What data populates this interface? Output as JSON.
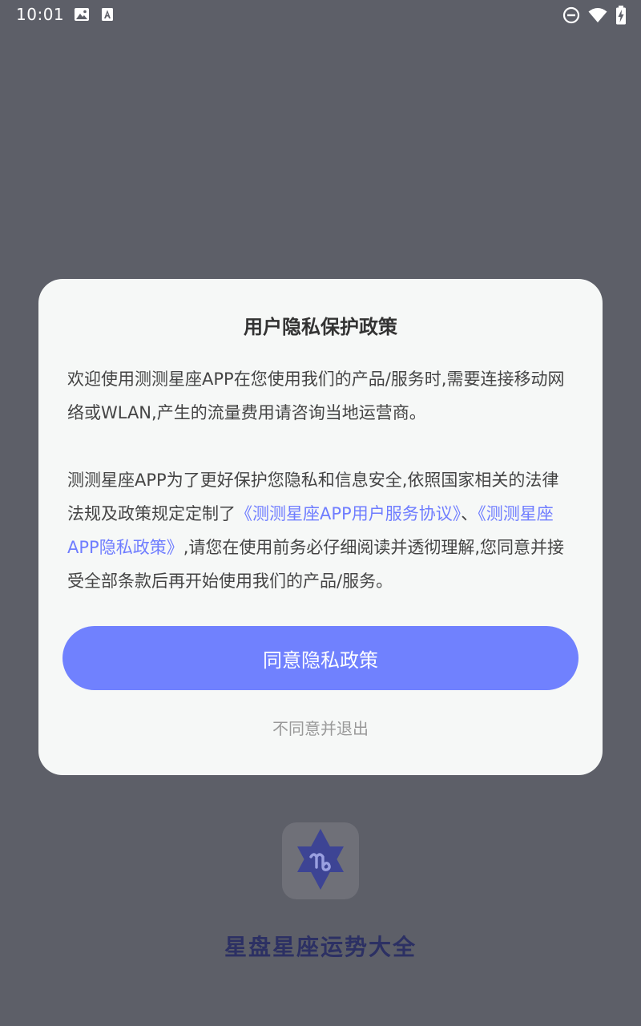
{
  "status_bar": {
    "time": "10:01",
    "icons": [
      "image-icon",
      "font-icon",
      "do-not-disturb-icon",
      "wifi-icon",
      "battery-charging-icon"
    ]
  },
  "dialog": {
    "title": "用户隐私保护政策",
    "paragraph1": "欢迎使用测测星座APP在您使用我们的产品/服务时,需要连接移动网络或WLAN,产生的流量费用请咨询当地运营商。",
    "paragraph2_part1": "测测星座APP为了更好保护您隐私和信息安全,依照国家相关的法律法规及政策规定定制了",
    "user_agreement_link": "《测测星座APP用户服务协议》",
    "separator": "、",
    "privacy_policy_link": "《测测星座APP隐私政策》",
    "paragraph2_part2": ",请您在使用前务必仔细阅读并透彻理解,您同意并接受全部条款后再开始使用我们的产品/服务。",
    "agree_label": "同意隐私政策",
    "decline_label": "不同意并退出"
  },
  "splash": {
    "app_name": "星盘星座运势大全",
    "logo_icon": "zodiac-star-icon"
  },
  "colors": {
    "accent": "#7081fe",
    "link": "#6f7dff",
    "overlay_bg": "#5d5f68",
    "dialog_bg": "#f6f8f7",
    "app_name": "#2c3063"
  }
}
